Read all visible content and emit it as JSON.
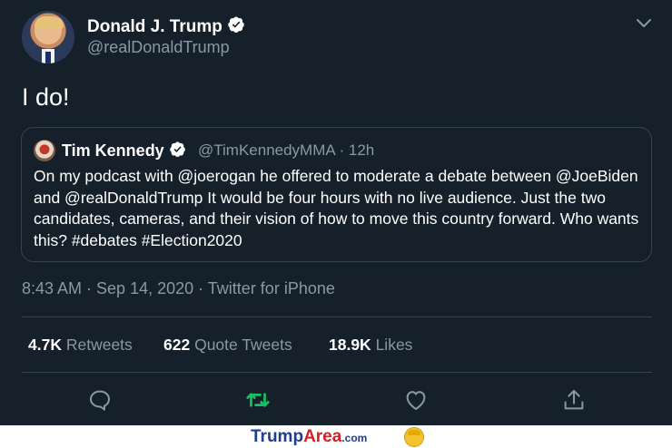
{
  "author": {
    "name": "Donald J. Trump",
    "handle": "@realDonaldTrump",
    "verified": true
  },
  "tweet_text": "I do!",
  "quoted_tweet": {
    "name": "Tim Kennedy",
    "verified": true,
    "handle_time": "@TimKennedyMMA · 12h",
    "text": "On my podcast with @joerogan he offered to moderate a debate between @JoeBiden and @realDonaldTrump It would be four hours with no live audience. Just the two candidates, cameras, and their vision of how to move this country forward. Who wants this? #debates #Election2020"
  },
  "meta": "8:43 AM · Sep 14, 2020 · Twitter for iPhone",
  "stats": {
    "retweets_count": "4.7K",
    "retweets_label": "Retweets",
    "quotes_count": "622",
    "quotes_label": "Quote Tweets",
    "likes_count": "18.9K",
    "likes_label": "Likes"
  },
  "actions": [
    "reply-icon",
    "retweet-icon",
    "like-icon",
    "share-icon"
  ],
  "colors": {
    "background": "#15202b",
    "secondary_text": "#8899a6",
    "border": "#38444d",
    "retweet_active": "#17bf63",
    "accent": "#1da1f2"
  },
  "watermark": {
    "part1": "Trump",
    "part2": "Area",
    "part3": ".com"
  }
}
